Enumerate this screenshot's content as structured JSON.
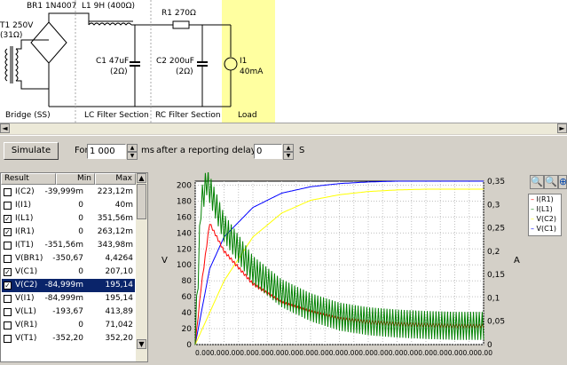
{
  "schematic": {
    "labels": {
      "transformer": "T1 250V",
      "transformer_r": "(31Ω)",
      "rectifier": "BR1 1N4007",
      "inductor": "L1 9H (400Ω)",
      "resistor": "R1 270Ω",
      "cap1": "C1 47uF",
      "cap1_r": "(2Ω)",
      "cap2": "C2 200uF",
      "cap2_r": "(2Ω)",
      "load_name": "I1",
      "load_val": "40mA"
    },
    "sections": {
      "bridge": "Bridge (SS)",
      "lc": "LC Filter Section",
      "rc": "RC Filter Section",
      "load": "Load"
    },
    "load_color": "#ffffa0"
  },
  "controls": {
    "simulate_label": "Simulate",
    "for_label": "For",
    "duration_value": "1 000",
    "ms_label": "ms",
    "delay_label": "after a reporting delay of",
    "delay_value": "0",
    "s_label": "S"
  },
  "table": {
    "headers": [
      "Result",
      "Min",
      "Max"
    ],
    "rows": [
      {
        "name": "I(C2)",
        "min": "-39,999m",
        "max": "223,12m",
        "checked": false,
        "selected": false
      },
      {
        "name": "I(I1)",
        "min": "0",
        "max": "40m",
        "checked": false,
        "selected": false
      },
      {
        "name": "I(L1)",
        "min": "0",
        "max": "351,56m",
        "checked": true,
        "selected": false
      },
      {
        "name": "I(R1)",
        "min": "0",
        "max": "263,12m",
        "checked": true,
        "selected": false
      },
      {
        "name": "I(T1)",
        "min": "-351,56m",
        "max": "343,98m",
        "checked": false,
        "selected": false
      },
      {
        "name": "V(BR1)",
        "min": "-350,67",
        "max": "4,4264",
        "checked": false,
        "selected": false
      },
      {
        "name": "V(C1)",
        "min": "0",
        "max": "207,10",
        "checked": true,
        "selected": false
      },
      {
        "name": "V(C2)",
        "min": "-84,999m",
        "max": "195,14",
        "checked": true,
        "selected": true
      },
      {
        "name": "V(I1)",
        "min": "-84,999m",
        "max": "195,14",
        "checked": false,
        "selected": false
      },
      {
        "name": "V(L1)",
        "min": "-193,67",
        "max": "413,89",
        "checked": false,
        "selected": false
      },
      {
        "name": "V(R1)",
        "min": "0",
        "max": "71,042",
        "checked": false,
        "selected": false
      },
      {
        "name": "V(T1)",
        "min": "-352,20",
        "max": "352,20",
        "checked": false,
        "selected": false
      }
    ]
  },
  "legend": {
    "items": [
      {
        "label": "I(R1)",
        "color": "#ff0000"
      },
      {
        "label": "I(L1)",
        "color": "#008000"
      },
      {
        "label": "V(C2)",
        "color": "#ffff00"
      },
      {
        "label": "V(C1)",
        "color": "#0000ff"
      }
    ]
  },
  "chart_data": {
    "type": "line",
    "ylabel_left": "V",
    "ylabel_right": "A",
    "left_ticks": [
      "200",
      "180",
      "160",
      "140",
      "120",
      "100",
      "80",
      "60",
      "40",
      "20",
      "0"
    ],
    "right_ticks": [
      "0,35",
      "0,3",
      "0,25",
      "0,2",
      "0,15",
      "0,1",
      "0,05",
      "0"
    ],
    "ylim_left": [
      0,
      205
    ],
    "ylim_right": [
      0,
      0.35
    ],
    "xlim": [
      0,
      1
    ],
    "xtick_label": "0.000.000.000.000.000.000.000.000.000.000.000.000.000.000.000.000.000.000.000.00",
    "grid": true,
    "series": [
      {
        "name": "V(C1)",
        "axis": "left",
        "color": "#0000ff",
        "x": [
          0,
          0.05,
          0.1,
          0.2,
          0.3,
          0.4,
          0.5,
          0.6,
          0.7,
          0.8,
          0.9,
          1.0
        ],
        "y": [
          0,
          95,
          135,
          172,
          190,
          198,
          202,
          204,
          205,
          205,
          205,
          205
        ]
      },
      {
        "name": "V(C2)",
        "axis": "left",
        "color": "#ffff00",
        "x": [
          0,
          0.05,
          0.1,
          0.2,
          0.3,
          0.4,
          0.5,
          0.6,
          0.7,
          0.8,
          0.9,
          1.0
        ],
        "y": [
          0,
          40,
          80,
          135,
          165,
          181,
          188,
          192,
          194,
          195,
          195,
          195
        ]
      },
      {
        "name": "I(R1)",
        "axis": "right",
        "color": "#ff0000",
        "x": [
          0,
          0.02,
          0.05,
          0.1,
          0.2,
          0.3,
          0.4,
          0.5,
          0.6,
          0.7,
          0.8,
          0.9,
          1.0
        ],
        "y": [
          0,
          0.12,
          0.26,
          0.2,
          0.13,
          0.09,
          0.07,
          0.055,
          0.048,
          0.044,
          0.042,
          0.04,
          0.04
        ]
      },
      {
        "name": "I(L1)",
        "axis": "right",
        "color": "#008000",
        "x": [
          0,
          0.02,
          0.04,
          0.1,
          0.2,
          0.3,
          0.4,
          0.5,
          0.6,
          0.7,
          0.8,
          0.9,
          1.0
        ],
        "y": [
          0,
          0.3,
          0.35,
          0.25,
          0.16,
          0.11,
          0.08,
          0.06,
          0.05,
          0.045,
          0.042,
          0.04,
          0.04
        ]
      }
    ]
  }
}
